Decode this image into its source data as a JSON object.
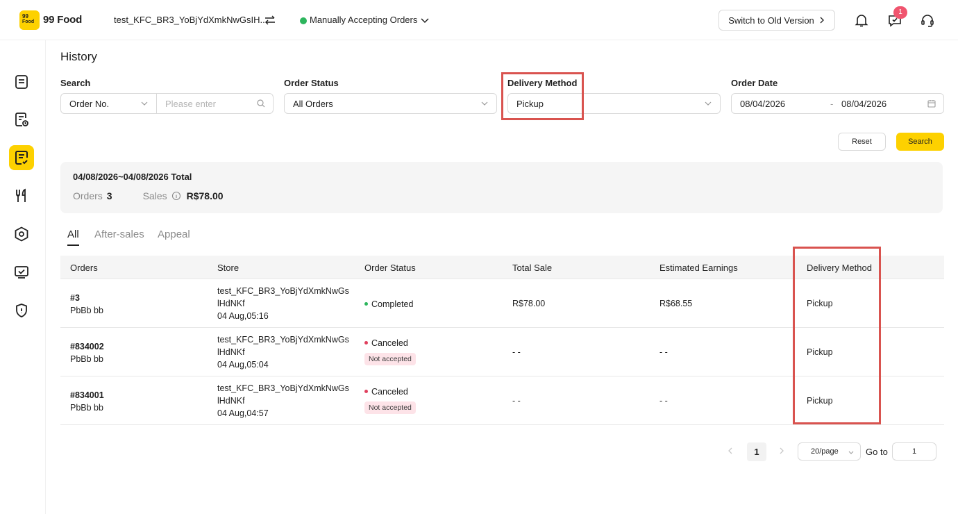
{
  "header": {
    "logo_small": "99",
    "logo_small2": "Food",
    "brand": "99 Food",
    "store_name": "test_KFC_BR3_YoBjYdXmkNwGsIH...",
    "order_mode": "Manually Accepting Orders",
    "old_version_label": "Switch to Old Version",
    "message_badge": "1"
  },
  "page": {
    "title": "History"
  },
  "filters": {
    "search_label": "Search",
    "search_type": "Order No.",
    "search_placeholder": "Please enter",
    "status_label": "Order Status",
    "status_value": "All Orders",
    "delivery_label": "Delivery Method",
    "delivery_value": "Pickup",
    "date_label": "Order Date",
    "date_from": "08/04/2026",
    "date_sep": "-",
    "date_to": "08/04/2026",
    "reset_label": "Reset",
    "search_button": "Search"
  },
  "summary": {
    "title": "04/08/2026~04/08/2026 Total",
    "orders_label": "Orders",
    "orders_value": "3",
    "sales_label": "Sales",
    "sales_value": "R$78.00"
  },
  "tabs": [
    "All",
    "After-sales",
    "Appeal"
  ],
  "table": {
    "headers": [
      "Orders",
      "Store",
      "Order Status",
      "Total Sale",
      "Estimated Earnings",
      "Delivery Method"
    ],
    "rows": [
      {
        "order_no": "#3",
        "customer": "PbBb bb",
        "store_line1": "test_KFC_BR3_YoBjYdXmkNwGs",
        "store_line2": "lHdNKf",
        "time": "04 Aug,05:16",
        "status": "Completed",
        "status_tag": "",
        "total": "R$78.00",
        "earnings": "R$68.55",
        "delivery": "Pickup"
      },
      {
        "order_no": "#834002",
        "customer": "PbBb bb",
        "store_line1": "test_KFC_BR3_YoBjYdXmkNwGs",
        "store_line2": "lHdNKf",
        "time": "04 Aug,05:04",
        "status": "Canceled",
        "status_tag": "Not accepted",
        "total": "- -",
        "earnings": "- -",
        "delivery": "Pickup"
      },
      {
        "order_no": "#834001",
        "customer": "PbBb bb",
        "store_line1": "test_KFC_BR3_YoBjYdXmkNwGs",
        "store_line2": "lHdNKf",
        "time": "04 Aug,04:57",
        "status": "Canceled",
        "status_tag": "Not accepted",
        "total": "- -",
        "earnings": "- -",
        "delivery": "Pickup"
      }
    ]
  },
  "pagination": {
    "current_page": "1",
    "page_size": "20/page",
    "goto_label": "Go to",
    "goto_value": "1"
  },
  "colors": {
    "accent": "#fdd100",
    "online": "#2db55d",
    "highlight": "#d9534f",
    "canceled": "#e0405e",
    "completed": "#2db55d",
    "tag_bg": "#fde3e8"
  }
}
